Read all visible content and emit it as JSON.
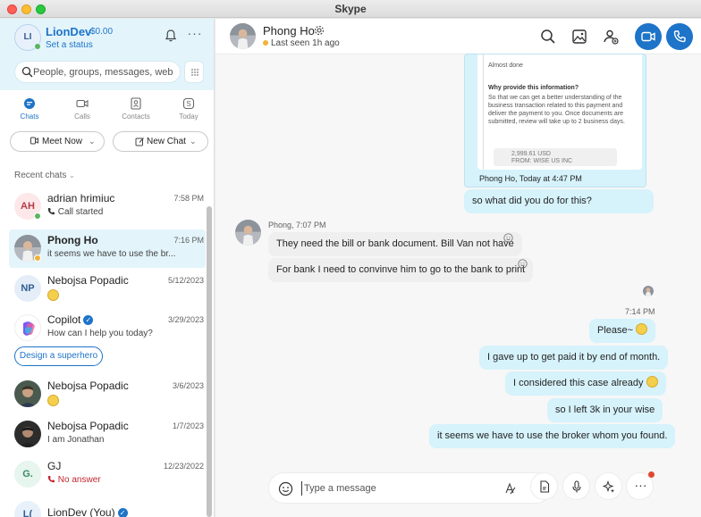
{
  "window": {
    "title": "Skype"
  },
  "profile": {
    "initials": "LI",
    "name": "LionDev",
    "balance": "$0.00",
    "status": "Set a status"
  },
  "search": {
    "placeholder": "People, groups, messages, web"
  },
  "nav": {
    "items": [
      {
        "label": "Chats",
        "active": true
      },
      {
        "label": "Calls",
        "active": false
      },
      {
        "label": "Contacts",
        "active": false
      },
      {
        "label": "Today",
        "active": false
      }
    ]
  },
  "actions": {
    "meet_now": "Meet Now",
    "new_chat": "New Chat"
  },
  "recent": {
    "label": "Recent chats"
  },
  "chats": [
    {
      "name": "adrian hrimiuc",
      "initials": "AH",
      "time": "7:58 PM",
      "preview": "Call started",
      "presence": "online"
    },
    {
      "name": "Phong Ho",
      "time": "7:16 PM",
      "preview": "it seems we have to use the br...",
      "presence": "away",
      "selected": true
    },
    {
      "name": "Nebojsa Popadic",
      "initials": "NP",
      "time": "5/12/2023",
      "preview_emoji": "thinking-face"
    },
    {
      "name": "Copilot",
      "time": "3/29/2023",
      "preview": "How can I help you today?",
      "verified": true,
      "action": "Design a superhero"
    },
    {
      "name": "Nebojsa Popadic",
      "time": "3/6/2023",
      "preview_emoji": "thinking-face"
    },
    {
      "name": "Nebojsa Popadic",
      "time": "1/7/2023",
      "preview": "I am Jonathan"
    },
    {
      "name": "GJ",
      "initials": "G.",
      "time": "12/23/2022",
      "preview": "No answer",
      "missed": true
    },
    {
      "name": "LionDev (You)",
      "initials": "L(",
      "verified": true
    }
  ],
  "conversation": {
    "name": "Phong Ho",
    "status": "Last seen 1h ago",
    "shared_card": {
      "status_text": "Almost done",
      "heading": "Why provide this information?",
      "body": "So that we can get a better understanding of the business transaction related to this payment and deliver the payment to you. Once documents are submitted, review will take up to 2 business days.",
      "amount": "2,999.61 USD",
      "from": "FROM: WISE US INC",
      "caption": "Phong Ho, Today at 4:47 PM"
    },
    "messages": [
      {
        "direction": "out",
        "text": "so what did you do for this?"
      },
      {
        "direction": "in",
        "meta": "Phong, 7:07 PM",
        "text": "They need the bill or bank document. Bill Van not have"
      },
      {
        "direction": "in",
        "text": "For bank I need to convinve him to go to the bank to print"
      },
      {
        "direction": "out",
        "meta": "7:14 PM",
        "text": "Please~",
        "emoji": "smile"
      },
      {
        "direction": "out",
        "text": "I gave up to get paid it by end of month."
      },
      {
        "direction": "out",
        "text": "I considered this case already",
        "emoji": "grin"
      },
      {
        "direction": "out",
        "text": "so I left 3k in your wise"
      },
      {
        "direction": "out",
        "text": "it seems we have to use the broker whom you found."
      }
    ],
    "composer": {
      "placeholder": "Type a message"
    }
  },
  "colors": {
    "accent": "#1d74c8",
    "outgoing_bubble": "#d6f2fb",
    "incoming_bubble": "#efefef",
    "sidebar_header": "#e3f4fb"
  }
}
